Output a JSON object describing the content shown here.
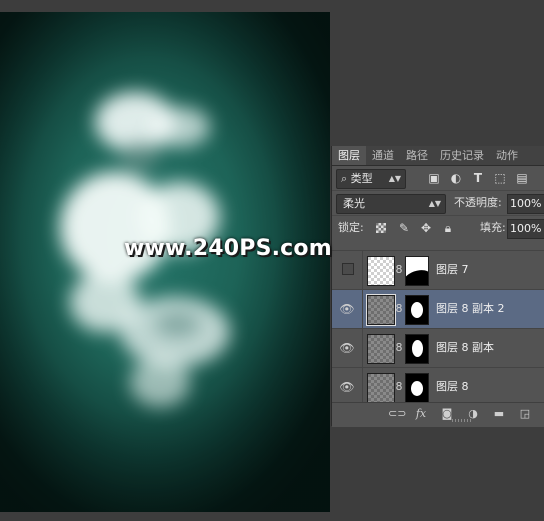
{
  "watermark": "www.240PS.com",
  "panel": {
    "tabs": [
      {
        "label": "图层",
        "active": true
      },
      {
        "label": "通道",
        "active": false
      },
      {
        "label": "路径",
        "active": false
      },
      {
        "label": "历史记录",
        "active": false
      },
      {
        "label": "动作",
        "active": false
      }
    ],
    "filter": {
      "label": "类型",
      "icons": [
        "image-filter-icon",
        "adjustment-filter-icon",
        "type-filter-icon",
        "shape-filter-icon",
        "smart-object-filter-icon"
      ]
    },
    "blend_mode": "柔光",
    "opacity_label": "不透明度:",
    "opacity_value": "100%",
    "lock_label": "锁定:",
    "fill_label": "填充:",
    "fill_value": "100%",
    "layers": [
      {
        "name": "图层 7",
        "visible": false,
        "selected": false
      },
      {
        "name": "图层 8 副本 2",
        "visible": true,
        "selected": true
      },
      {
        "name": "图层 8 副本",
        "visible": true,
        "selected": false
      },
      {
        "name": "图层 8",
        "visible": true,
        "selected": false
      }
    ],
    "footer_icons": [
      "link-layers-icon",
      "fx-icon",
      "add-mask-icon",
      "adjustment-layer-icon",
      "new-group-icon",
      "new-layer-icon"
    ],
    "colors": {
      "panel_bg": "#535353",
      "selected_row": "#5b6a84",
      "canvas_teal": "#1d6357"
    }
  }
}
